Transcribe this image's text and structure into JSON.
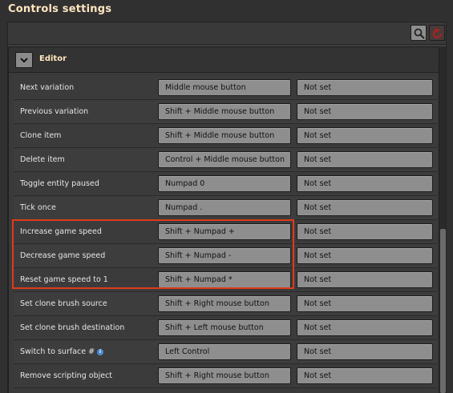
{
  "window": {
    "title": "Controls settings"
  },
  "toolbar": {
    "search_icon": "search-icon",
    "reset_icon": "reset-icon"
  },
  "section": {
    "title": "Editor",
    "collapse_icon": "chevron-down-icon"
  },
  "rows": [
    {
      "label": "Next variation",
      "primary": "Middle mouse button",
      "secondary": "Not set"
    },
    {
      "label": "Previous variation",
      "primary": "Shift + Middle mouse button",
      "secondary": "Not set"
    },
    {
      "label": "Clone item",
      "primary": "Shift + Middle mouse button",
      "secondary": "Not set"
    },
    {
      "label": "Delete item",
      "primary": "Control + Middle mouse button",
      "secondary": "Not set"
    },
    {
      "label": "Toggle entity paused",
      "primary": "Numpad 0",
      "secondary": "Not set"
    },
    {
      "label": "Tick once",
      "primary": "Numpad .",
      "secondary": "Not set"
    },
    {
      "label": "Increase game speed",
      "primary": "Shift + Numpad +",
      "secondary": "Not set"
    },
    {
      "label": "Decrease game speed",
      "primary": "Shift + Numpad -",
      "secondary": "Not set"
    },
    {
      "label": "Reset game speed to 1",
      "primary": "Shift + Numpad *",
      "secondary": "Not set"
    },
    {
      "label": "Set clone brush source",
      "primary": "Shift + Right mouse button",
      "secondary": "Not set"
    },
    {
      "label": "Set clone brush destination",
      "primary": "Shift + Left mouse button",
      "secondary": "Not set"
    },
    {
      "label": "Switch to surface #",
      "primary": "Left Control",
      "secondary": "Not set",
      "info": "i"
    },
    {
      "label": "Remove scripting object",
      "primary": "Shift + Right mouse button",
      "secondary": "Not set"
    }
  ],
  "colors": {
    "title": "#ffe6c0",
    "highlight": "#e03a1a",
    "button": "#8e8e8e"
  }
}
